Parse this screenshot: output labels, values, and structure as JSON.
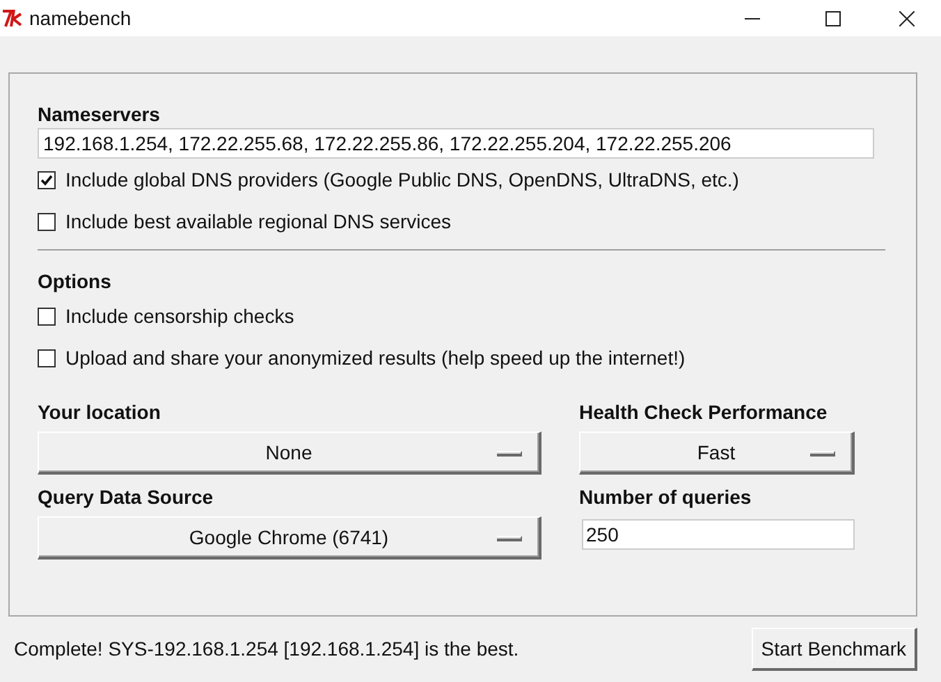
{
  "window": {
    "title": "namebench"
  },
  "nameservers": {
    "heading": "Nameservers",
    "value": "192.168.1.254, 172.22.255.68, 172.22.255.86, 172.22.255.204, 172.22.255.206",
    "options": [
      {
        "label": "Include global DNS providers (Google Public DNS, OpenDNS, UltraDNS, etc.)",
        "checked": true
      },
      {
        "label": "Include best available regional DNS services",
        "checked": false
      }
    ]
  },
  "options": {
    "heading": "Options",
    "items": [
      {
        "label": "Include censorship checks",
        "checked": false
      },
      {
        "label": "Upload and share your anonymized results (help speed up the internet!)",
        "checked": false
      }
    ]
  },
  "location": {
    "label": "Your location",
    "value": "None"
  },
  "health_check": {
    "label": "Health Check Performance",
    "value": "Fast"
  },
  "query_source": {
    "label": "Query Data Source",
    "value": "Google Chrome (6741)"
  },
  "queries": {
    "label": "Number of queries",
    "value": "250"
  },
  "status_bar": {
    "message": "Complete! SYS-192.168.1.254 [192.168.1.254] is the best.",
    "button": "Start Benchmark"
  }
}
